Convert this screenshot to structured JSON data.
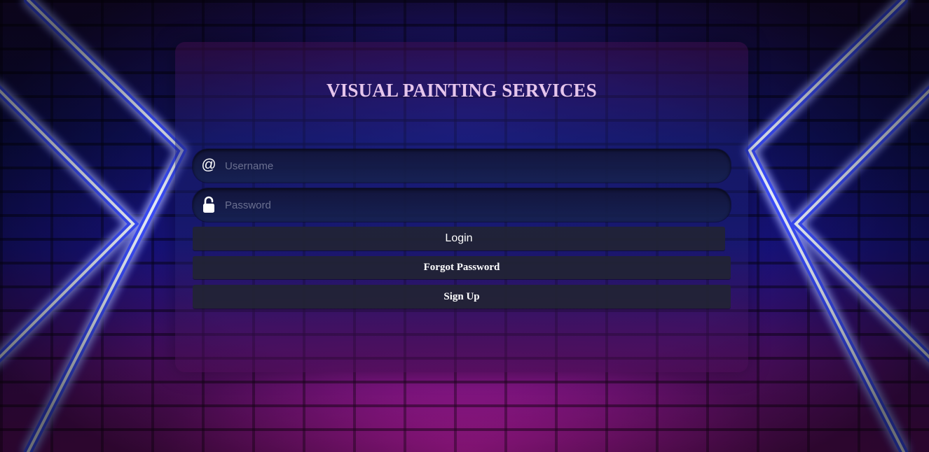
{
  "page": {
    "title": "VISUAL PAINTING SERVICES"
  },
  "login_form": {
    "username": {
      "icon": "at-sign-icon",
      "icon_glyph": "@",
      "placeholder": "Username",
      "value": ""
    },
    "password": {
      "icon": "lock-icon",
      "placeholder": "Password",
      "value": ""
    },
    "login_label": "Login",
    "forgot_password_label": "Forgot Password",
    "sign_up_label": "Sign Up"
  },
  "colors": {
    "title": "#e6c6ec",
    "button_bg": "#222434",
    "button_text": "#ffffff",
    "neon_blue": "#2a3cff",
    "neon_core": "#e8f0ff",
    "brick_magenta": "#8a1a8a"
  }
}
